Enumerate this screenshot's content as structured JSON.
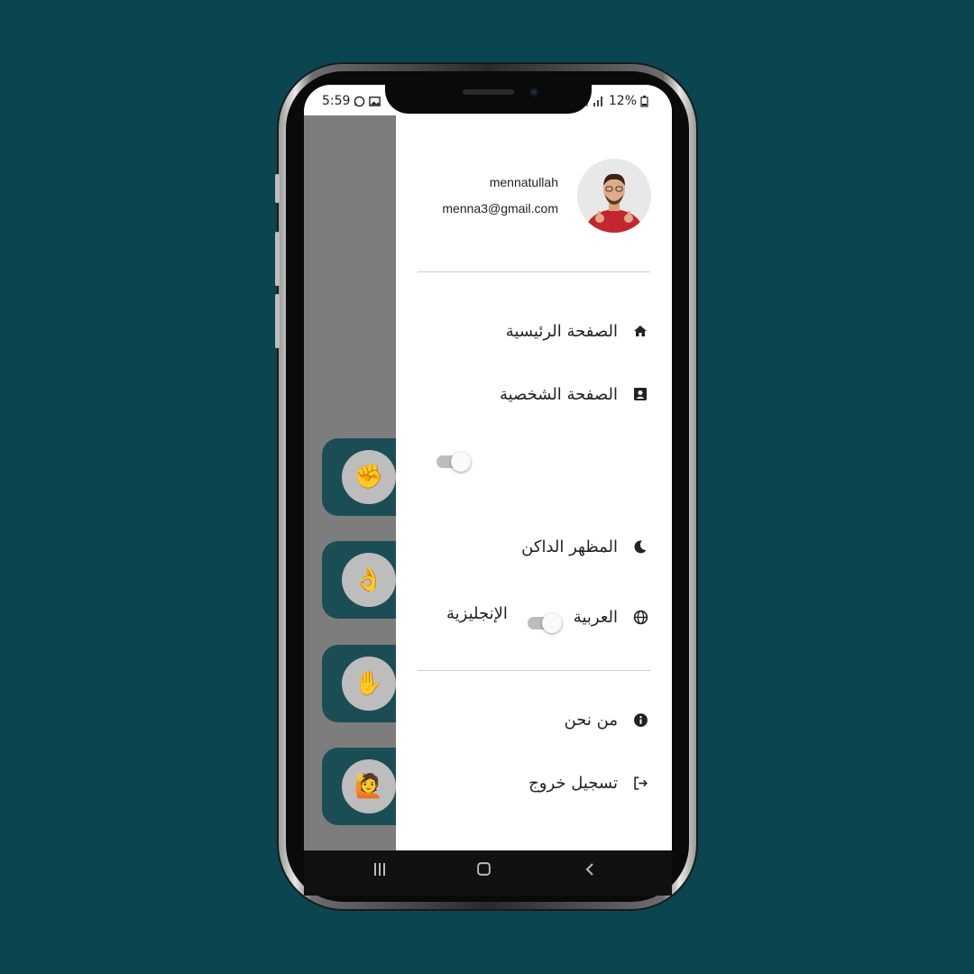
{
  "statusbar": {
    "time": "5:59",
    "battery": "12%"
  },
  "drawer": {
    "user_name": "mennatullah",
    "user_email": "menna3@gmail.com",
    "menu": [
      {
        "label": "الصفحة الرئيسية",
        "icon": "home-icon"
      },
      {
        "label": "الصفحة الشخصية",
        "icon": "profile-icon"
      },
      {
        "label": "المظهر الداكن",
        "icon": "moon-icon"
      },
      {
        "label": "العربية",
        "icon": "globe-icon",
        "alt_label": "الإنجليزية"
      }
    ],
    "secondary": [
      {
        "label": "من نحن",
        "icon": "info-icon"
      },
      {
        "label": "تسجيل خروج",
        "icon": "logout-icon"
      }
    ]
  },
  "colors": {
    "background": "#0b4650",
    "card": "#1b4d55",
    "overlay": "#7d7d7d"
  }
}
